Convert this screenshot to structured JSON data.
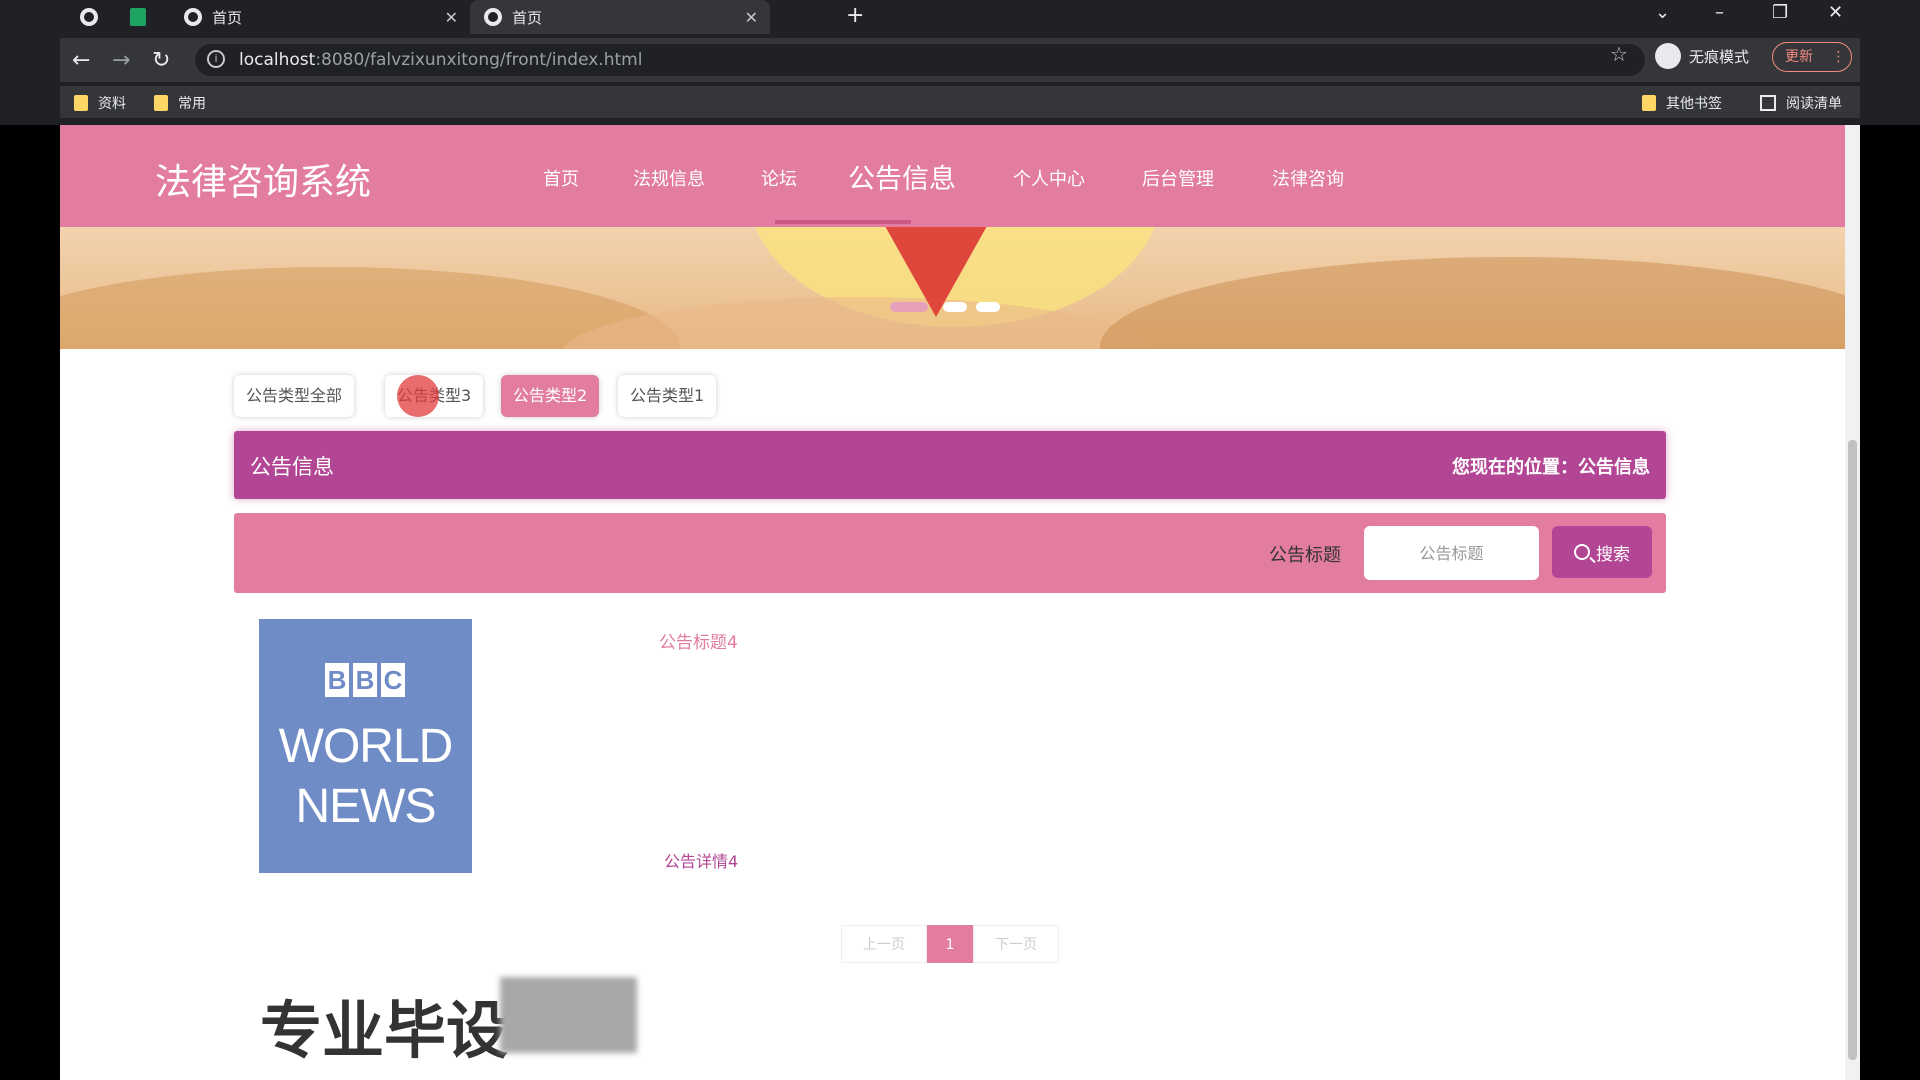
{
  "browser": {
    "tabs": [
      {
        "label": "首页",
        "active": false
      },
      {
        "label": "首页",
        "active": true
      }
    ],
    "address": {
      "host": "localhost",
      "path": ":8080/falvzixunxitong/front/index.html"
    },
    "incognito_label": "无痕模式",
    "update_label": "更新",
    "bookmarks": [
      "资料",
      "常用"
    ],
    "other_bookmarks": "其他书签",
    "reading_list": "阅读清单"
  },
  "site": {
    "brand": "法律咨询系统",
    "menu": [
      {
        "label": "首页",
        "active": false
      },
      {
        "label": "法规信息",
        "active": false
      },
      {
        "label": "论坛",
        "active": false
      },
      {
        "label": "公告信息",
        "active": true
      },
      {
        "label": "个人中心",
        "active": false
      },
      {
        "label": "后台管理",
        "active": false
      },
      {
        "label": "法律咨询",
        "active": false
      }
    ],
    "accent": "#e27ca0",
    "accent_dark": "#b24594"
  },
  "filters": [
    {
      "label": "公告类型全部",
      "active": false
    },
    {
      "label": "公告类型3",
      "active": false
    },
    {
      "label": "公告类型2",
      "active": true
    },
    {
      "label": "公告类型1",
      "active": false
    }
  ],
  "section": {
    "title": "公告信息",
    "position": "您现在的位置：公告信息"
  },
  "search": {
    "label": "公告标题",
    "placeholder": "公告标题",
    "button": "搜索"
  },
  "news": [
    {
      "thumb_lines": [
        "BBC",
        "WORLD",
        "NEWS"
      ],
      "title": "公告标题4",
      "detail": "公告详情4"
    }
  ],
  "pagination": {
    "prev": "上一页",
    "current": "1",
    "next": "下一页"
  },
  "watermark": "专业毕设"
}
